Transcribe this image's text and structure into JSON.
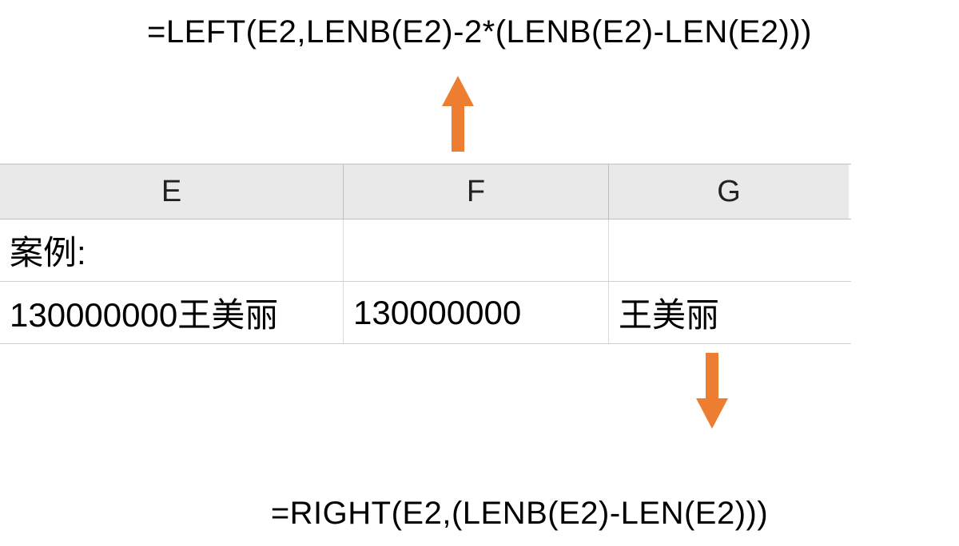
{
  "formula_top": "=LEFT(E2,LENB(E2)-2*(LENB(E2)-LEN(E2)))",
  "formula_bottom": "=RIGHT(E2,(LENB(E2)-LEN(E2)))",
  "table": {
    "headers": {
      "E": "E",
      "F": "F",
      "G": "G"
    },
    "rows": [
      {
        "E": "案例:",
        "F": "",
        "G": ""
      },
      {
        "E": "130000000王美丽",
        "F": "130000000",
        "G": "王美丽"
      }
    ]
  },
  "arrow_color": "#ED7D31"
}
